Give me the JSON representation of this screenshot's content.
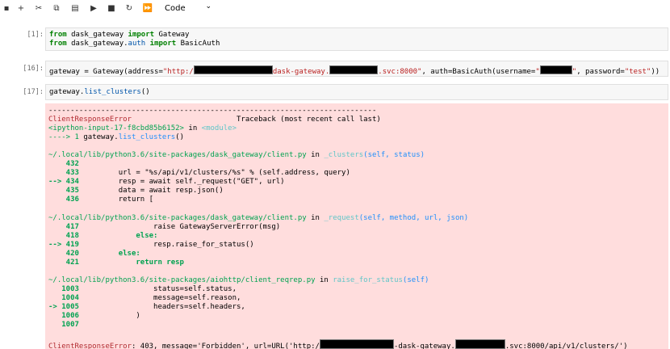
{
  "toolbar": {
    "buttons": [
      {
        "name": "save-icon",
        "glyph": "▪"
      },
      {
        "name": "add-cell-icon",
        "glyph": "+"
      },
      {
        "name": "cut-icon",
        "glyph": "✂"
      },
      {
        "name": "copy-icon",
        "glyph": "⧉"
      },
      {
        "name": "paste-icon",
        "glyph": "▤"
      },
      {
        "name": "run-icon",
        "glyph": "▶"
      },
      {
        "name": "stop-icon",
        "glyph": "■"
      },
      {
        "name": "restart-icon",
        "glyph": "↻"
      },
      {
        "name": "run-all-icon",
        "glyph": "⏩"
      }
    ],
    "cell_type": "Code",
    "cell_type_chevron": "⌄"
  },
  "cells": {
    "c1": {
      "prompt": "[1]:",
      "line1": {
        "k1": "from",
        "t1": " dask_gateway ",
        "k2": "import",
        "t2": " Gateway"
      },
      "line2": {
        "k1": "from",
        "t1": " dask_gateway.",
        "f1": "auth",
        "t2": " ",
        "k2": "import",
        "t3": " BasicAuth"
      }
    },
    "c2": {
      "prompt": "[16]:",
      "p1": "gateway = Gateway(address=",
      "s1": "\"http:/",
      "s2": "dask-gateway.",
      "s3": ".svc:8000\"",
      "p2": ", auth=BasicAuth(username=",
      "s4": "\"",
      "s5": "\"",
      "p3": ", password=",
      "s6": "\"test\"",
      "p4": "))"
    },
    "c3": {
      "prompt": "[17]:",
      "p1": "gateway.",
      "f1": "list_clusters",
      "p2": "()"
    }
  },
  "traceback": {
    "dashes": "---------------------------------------------------------------------------",
    "err_name": "ClientResponseError",
    "tb_label": "                        Traceback (most recent call last)",
    "input_ref": "<ipython-input-17-f8cbd85b6152>",
    "in_word": " in ",
    "module": "<module>",
    "arrow1": "----> 1 ",
    "arrow1_code_a": "gateway.",
    "arrow1_code_b": "list_clusters",
    "arrow1_code_c": "()",
    "f1_path": "~/.local/lib/python3.6/site-packages/dask_gateway/client.py",
    "f1_in": " in ",
    "f1_func": "_clusters",
    "f1_args": "(self, status)",
    "f1_lines": [
      {
        "no": "    432",
        "code": ""
      },
      {
        "no": "    433",
        "code": "         url = \"%s/api/v1/clusters/%s\" % (self.address, query)"
      },
      {
        "no": "--> 434",
        "code": "         resp = await self._request(\"GET\", url)"
      },
      {
        "no": "    435",
        "code": "         data = await resp.json()"
      },
      {
        "no": "    436",
        "code": "         return ["
      }
    ],
    "f2_path": "~/.local/lib/python3.6/site-packages/dask_gateway/client.py",
    "f2_in": " in ",
    "f2_func": "_request",
    "f2_args": "(self, method, url, json)",
    "f2_lines": [
      {
        "no": "    417",
        "code": "                 raise GatewayServerError(msg)"
      },
      {
        "no": "    418",
        "code": "             else:"
      },
      {
        "no": "--> 419",
        "code": "                 resp.raise_for_status()"
      },
      {
        "no": "    420",
        "code": "         else:"
      },
      {
        "no": "    421",
        "code": "             return resp"
      }
    ],
    "f3_path": "~/.local/lib/python3.6/site-packages/aiohttp/client_reqrep.py",
    "f3_in": " in ",
    "f3_func": "raise_for_status",
    "f3_args": "(self)",
    "f3_lines": [
      {
        "no": "   1003",
        "code": "                 status=self.status,"
      },
      {
        "no": "   1004",
        "code": "                 message=self.reason,"
      },
      {
        "no": "-> 1005",
        "code": "                 headers=self.headers,"
      },
      {
        "no": "   1006",
        "code": "             )"
      },
      {
        "no": "   1007",
        "code": ""
      }
    ],
    "final_err": "ClientResponseError",
    "final_a": ": 403, message='Forbidden', url=URL('http:/",
    "final_b": "-dask-gateway.",
    "final_c": ".svc:8000/api/v1/clusters/')"
  }
}
